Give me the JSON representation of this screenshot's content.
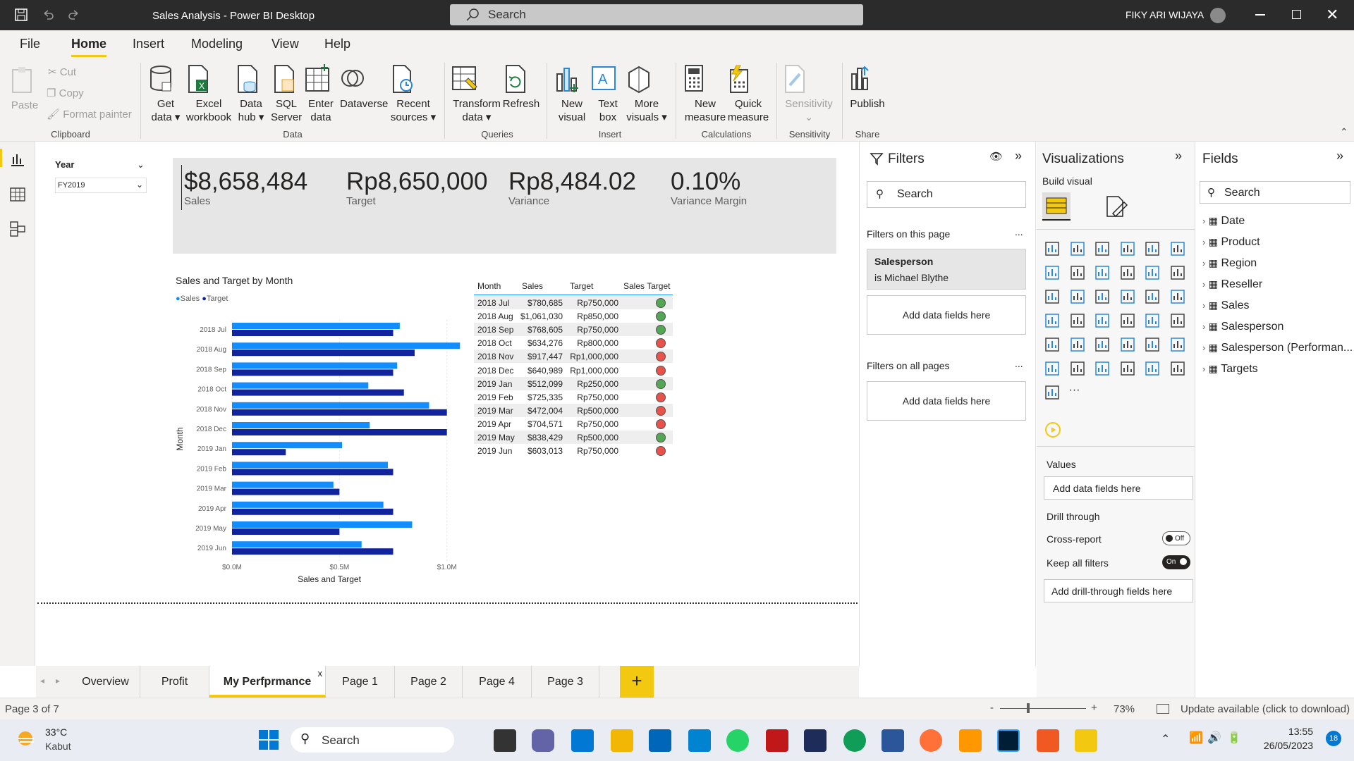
{
  "window": {
    "title": "Sales Analysis - Power BI Desktop",
    "search": "Search",
    "user": "FIKY ARI WIJAYA"
  },
  "menu": [
    "File",
    "Home",
    "Insert",
    "Modeling",
    "View",
    "Help"
  ],
  "ribbon": {
    "clipboard": {
      "paste": "Paste",
      "cut": "Cut",
      "copy": "Copy",
      "format": "Format painter",
      "group": "Clipboard"
    },
    "data": {
      "get_data": [
        "Get",
        "data"
      ],
      "excel": [
        "Excel",
        "workbook"
      ],
      "hub": [
        "Data",
        "hub"
      ],
      "sql": [
        "SQL",
        "Server"
      ],
      "enter": [
        "Enter",
        "data"
      ],
      "dataverse": "Dataverse",
      "recent": [
        "Recent",
        "sources"
      ],
      "group": "Data"
    },
    "queries": {
      "transform": [
        "Transform",
        "data"
      ],
      "refresh": "Refresh",
      "group": "Queries"
    },
    "insert": {
      "new_visual": [
        "New",
        "visual"
      ],
      "text_box": [
        "Text",
        "box"
      ],
      "more": [
        "More",
        "visuals"
      ],
      "group": "Insert"
    },
    "calc": {
      "new_measure": [
        "New",
        "measure"
      ],
      "quick": [
        "Quick",
        "measure"
      ],
      "group": "Calculations"
    },
    "sensitivity": {
      "label": "Sensitivity",
      "group": "Sensitivity"
    },
    "share": {
      "publish": "Publish",
      "group": "Share"
    }
  },
  "slicer": {
    "title": "Year",
    "value": "FY2019"
  },
  "kpis": [
    {
      "value": "$8,658,484",
      "label": "Sales"
    },
    {
      "value": "Rp8,650,000",
      "label": "Target"
    },
    {
      "value": "Rp8,484.02",
      "label": "Variance"
    },
    {
      "value": "0.10%",
      "label": "Variance Margin"
    }
  ],
  "chart_data": {
    "type": "bar",
    "title": "Sales and Target by Month",
    "xlabel": "Sales and Target",
    "ylabel": "Month",
    "categories": [
      "2018 Jul",
      "2018 Aug",
      "2018 Sep",
      "2018 Oct",
      "2018 Nov",
      "2018 Dec",
      "2019 Jan",
      "2019 Feb",
      "2019 Mar",
      "2019 Apr",
      "2019 May",
      "2019 Jun"
    ],
    "series": [
      {
        "name": "Sales",
        "color": "#118dff",
        "values": [
          780685,
          1061030,
          768605,
          634276,
          917447,
          640989,
          512099,
          725335,
          472004,
          704571,
          838429,
          603013
        ]
      },
      {
        "name": "Target",
        "color": "#12239e",
        "values": [
          750000,
          850000,
          750000,
          800000,
          1000000,
          1000000,
          250000,
          750000,
          500000,
          750000,
          500000,
          750000
        ]
      }
    ],
    "xticks": [
      "$0.0M",
      "$0.5M",
      "$1.0M"
    ],
    "xlim": [
      0,
      1070000
    ],
    "orientation": "horizontal",
    "legend": "top-left"
  },
  "table": {
    "headers": [
      "Month",
      "Sales",
      "Target",
      "Sales Target"
    ],
    "rows": [
      {
        "month": "2018 Jul",
        "sales": "$780,685",
        "target": "Rp750,000",
        "status": "good"
      },
      {
        "month": "2018 Aug",
        "sales": "$1,061,030",
        "target": "Rp850,000",
        "status": "good"
      },
      {
        "month": "2018 Sep",
        "sales": "$768,605",
        "target": "Rp750,000",
        "status": "good"
      },
      {
        "month": "2018 Oct",
        "sales": "$634,276",
        "target": "Rp800,000",
        "status": "bad"
      },
      {
        "month": "2018 Nov",
        "sales": "$917,447",
        "target": "Rp1,000,000",
        "status": "bad"
      },
      {
        "month": "2018 Dec",
        "sales": "$640,989",
        "target": "Rp1,000,000",
        "status": "bad"
      },
      {
        "month": "2019 Jan",
        "sales": "$512,099",
        "target": "Rp250,000",
        "status": "good"
      },
      {
        "month": "2019 Feb",
        "sales": "$725,335",
        "target": "Rp750,000",
        "status": "bad"
      },
      {
        "month": "2019 Mar",
        "sales": "$472,004",
        "target": "Rp500,000",
        "status": "bad"
      },
      {
        "month": "2019 Apr",
        "sales": "$704,571",
        "target": "Rp750,000",
        "status": "bad"
      },
      {
        "month": "2019 May",
        "sales": "$838,429",
        "target": "Rp500,000",
        "status": "good"
      },
      {
        "month": "2019 Jun",
        "sales": "$603,013",
        "target": "Rp750,000",
        "status": "bad"
      }
    ],
    "status_colors": {
      "good": "#53a653",
      "bad": "#e8524a"
    }
  },
  "filters": {
    "title": "Filters",
    "search": "Search",
    "on_page": "Filters on this page",
    "card_title": "Salesperson",
    "card_value": "is Michael Blythe",
    "add": "Add data fields here",
    "all_pages": "Filters on all pages",
    "add2": "Add data fields here",
    "more": "..."
  },
  "viz": {
    "title": "Visualizations",
    "build": "Build visual",
    "values": "Values",
    "values_add": "Add data fields here",
    "drill": "Drill through",
    "cross": "Cross-report",
    "cross_state": "Off",
    "keep": "Keep all filters",
    "keep_state": "On",
    "drill_add": "Add drill-through fields here"
  },
  "fields": {
    "title": "Fields",
    "search": "Search",
    "items": [
      "Date",
      "Product",
      "Region",
      "Reseller",
      "Sales",
      "Salesperson",
      "Salesperson (Performan...",
      "Targets"
    ]
  },
  "pages": {
    "tabs": [
      "Overview",
      "Profit",
      "My Perfprmance",
      "Page 1",
      "Page 2",
      "Page 4",
      "Page 3"
    ],
    "active": "My Perfprmance",
    "close": "x",
    "add": "+"
  },
  "status": {
    "page": "Page 3 of 7",
    "zoom": "73%",
    "update": "Update available (click to download)",
    "minus": "-",
    "plus": "+"
  },
  "taskbar": {
    "temp": "33°C",
    "weather": "Kabut",
    "search": "Search",
    "time": "13:55",
    "date": "26/05/2023",
    "badge": "18"
  }
}
